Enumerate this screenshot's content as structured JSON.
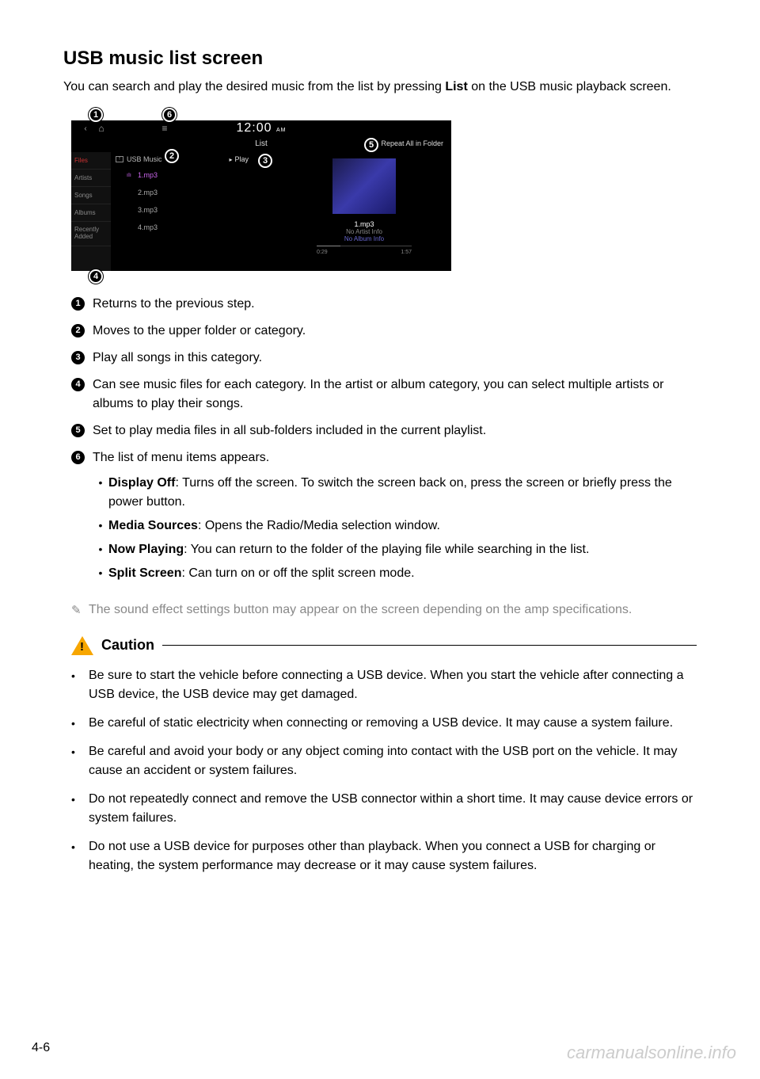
{
  "title": "USB music list screen",
  "intro_1": "You can search and play the desired music from the list by pressing ",
  "intro_strong": "List",
  "intro_2": " on the USB music playback screen.",
  "screen": {
    "clock": "12:00",
    "ampm": "AM",
    "header_title": "List",
    "repeat_label": "Repeat All in Folder",
    "up_folder_label": "USB Music",
    "play_all_label": "Play",
    "sidebar": [
      "Files",
      "Artists",
      "Songs",
      "Albums",
      "Recently Added"
    ],
    "files": [
      "1.mp3",
      "2.mp3",
      "3.mp3",
      "4.mp3"
    ],
    "np_track": "1.mp3",
    "np_artist": "No Artist Info",
    "np_album": "No Album Info",
    "np_elapsed": "0:29",
    "np_total": "1:57"
  },
  "callouts": {
    "c1": "1",
    "c2": "2",
    "c3": "3",
    "c4": "4",
    "c5": "5",
    "c6": "6"
  },
  "items": {
    "i1": "Returns to the previous step.",
    "i2": "Moves to the upper folder or category.",
    "i3": "Play all songs in this category.",
    "i4": "Can see music files for each category. In the artist or album category, you can select multiple artists or albums to play their songs.",
    "i5": "Set to play media files in all sub-folders included in the current playlist.",
    "i6": "The list of menu items appears."
  },
  "submenu": {
    "s1b": "Display Off",
    "s1t": ": Turns off the screen. To switch the screen back on, press the screen or briefly press the power button.",
    "s2b": "Media Sources",
    "s2t": ": Opens the Radio/Media selection window.",
    "s3b": "Now Playing",
    "s3t": ": You can return to the folder of the playing file while searching in the list.",
    "s4b": "Split Screen",
    "s4t": ": Can turn on or off the split screen mode."
  },
  "note": "The sound effect settings button may appear on the screen depending on the amp specifications.",
  "caution_label": "Caution",
  "cautions": {
    "c1": "Be sure to start the vehicle before connecting a USB device. When you start the vehicle after connecting a USB device, the USB device may get damaged.",
    "c2": "Be careful of static electricity when connecting or removing a USB device. It may cause a system failure.",
    "c3": "Be careful and avoid your body or any object coming into contact with the USB port on the vehicle. It may cause an accident or system failures.",
    "c4": "Do not repeatedly connect and remove the USB connector within a short time. It may cause device errors or system failures.",
    "c5": "Do not use a USB device for purposes other than playback. When you connect a USB for charging or heating, the system performance may decrease or it may cause system failures."
  },
  "page_num": "4-6",
  "watermark": "carmanualsonline.info"
}
